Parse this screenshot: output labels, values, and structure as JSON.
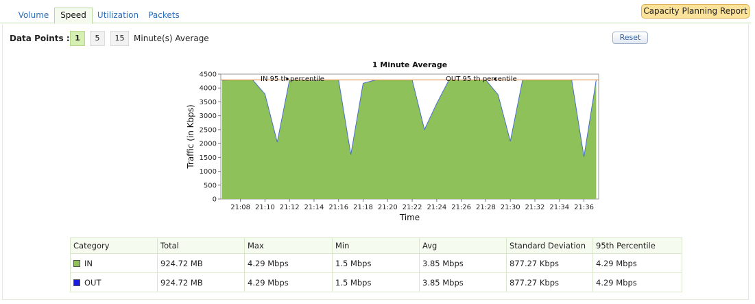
{
  "tabs": [
    {
      "label": "Volume",
      "active": false
    },
    {
      "label": "Speed",
      "active": true
    },
    {
      "label": "Utilization",
      "active": false
    },
    {
      "label": "Packets",
      "active": false
    }
  ],
  "report_button": "Capacity Planning Report",
  "data_points": {
    "label": "Data Points :",
    "options": [
      "1",
      "5",
      "15"
    ],
    "selected": "1",
    "suffix": "Minute(s) Average"
  },
  "reset_label": "Reset",
  "chart_data": {
    "type": "area",
    "title": "1 Minute Average",
    "xlabel": "Time",
    "ylabel": "Traffic (in Kbps)",
    "ylim": [
      0,
      4500
    ],
    "yticks": [
      0,
      500,
      1000,
      1500,
      2000,
      2500,
      3000,
      3500,
      4000,
      4500
    ],
    "xticks": [
      "21:08",
      "21:10",
      "21:12",
      "21:14",
      "21:16",
      "21:18",
      "21:20",
      "21:22",
      "21:24",
      "21:26",
      "21:28",
      "21:30",
      "21:32",
      "21:34",
      "21:36"
    ],
    "x_range_minutes": [
      "21:06.4",
      "21:37.2"
    ],
    "grid": false,
    "colors": {
      "IN": "#8ec15a",
      "OUT": "#4a6fcf",
      "percentile": "#e07a2a"
    },
    "series": [
      {
        "name": "IN",
        "x": [
          "21:06.5",
          "21:07",
          "21:08",
          "21:09",
          "21:10",
          "21:11",
          "21:12",
          "21:13",
          "21:14",
          "21:15",
          "21:16",
          "21:17",
          "21:18",
          "21:19",
          "21:20",
          "21:21",
          "21:22",
          "21:23",
          "21:24",
          "21:25",
          "21:26",
          "21:27",
          "21:28",
          "21:29",
          "21:30",
          "21:31",
          "21:32",
          "21:33",
          "21:34",
          "21:35",
          "21:36",
          "21:37"
        ],
        "values": [
          4280,
          4290,
          4290,
          4290,
          3780,
          2050,
          4290,
          4290,
          4280,
          4290,
          4290,
          1600,
          4170,
          4290,
          4290,
          4290,
          4290,
          2500,
          3440,
          4290,
          4290,
          4290,
          4290,
          3760,
          2080,
          4290,
          4290,
          4290,
          4290,
          4290,
          1520,
          4290
        ]
      }
    ],
    "percentile_lines": [
      {
        "label": "IN 95 th percentile",
        "value": 4290
      },
      {
        "label": "OUT 95 th percentile",
        "value": 4290
      }
    ]
  },
  "table": {
    "headers": [
      "Category",
      "Total",
      "Max",
      "Min",
      "Avg",
      "Standard Deviation",
      "95th Percentile"
    ],
    "rows": [
      {
        "color": "#8ec15a",
        "cells": [
          "IN",
          "924.72 MB",
          "4.29 Mbps",
          "1.5 Mbps",
          "3.85 Mbps",
          "877.27 Kbps",
          "4.29 Mbps"
        ]
      },
      {
        "color": "#1a1ae0",
        "cells": [
          "OUT",
          "924.72 MB",
          "4.29 Mbps",
          "1.5 Mbps",
          "3.85 Mbps",
          "877.27 Kbps",
          "4.29 Mbps"
        ]
      }
    ]
  }
}
